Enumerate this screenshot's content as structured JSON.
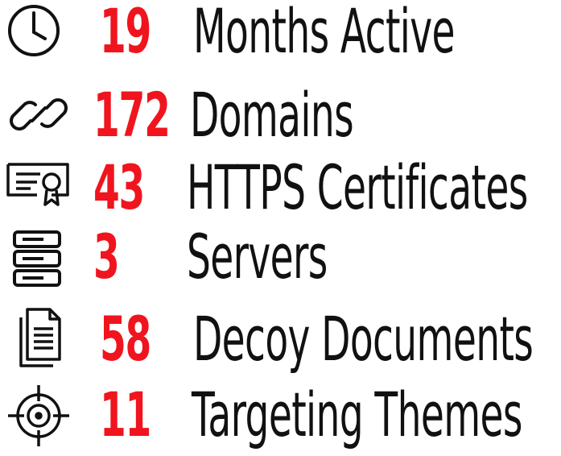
{
  "stats": [
    {
      "number": "19",
      "label": "Months Active",
      "icon": "clock-icon"
    },
    {
      "number": "172",
      "label": "Domains",
      "icon": "chain-link-icon"
    },
    {
      "number": "43",
      "label": "HTTPS Certificates",
      "icon": "certificate-icon"
    },
    {
      "number": "3",
      "label": "Servers",
      "icon": "server-icon"
    },
    {
      "number": "58",
      "label": "Decoy Documents",
      "icon": "document-icon"
    },
    {
      "number": "11",
      "label": "Targeting Themes",
      "icon": "crosshair-icon"
    }
  ],
  "colors": {
    "number": "#f0141e",
    "label": "#111111",
    "icon": "#111111",
    "background": "#ffffff"
  }
}
